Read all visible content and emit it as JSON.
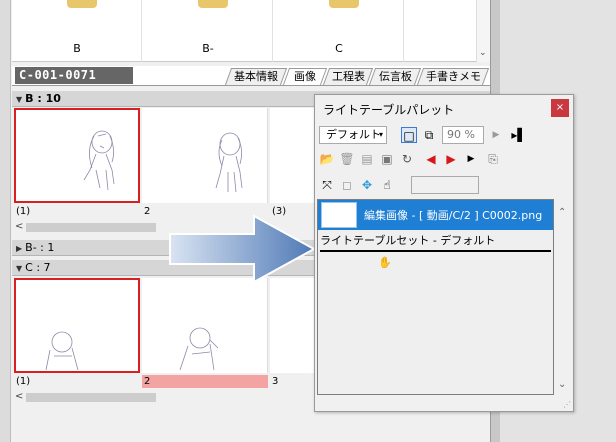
{
  "folders": [
    {
      "label": "B"
    },
    {
      "label": "B-"
    },
    {
      "label": "C"
    }
  ],
  "header": {
    "cut_title": "C-001-0071",
    "tabs": [
      "基本情報",
      "画像",
      "工程表",
      "伝言板",
      "手書きメモ"
    ]
  },
  "groups": [
    {
      "name": "B",
      "count": "10",
      "expanded": true,
      "thumbs": [
        {
          "label": "(1)",
          "selected": true
        },
        {
          "label": "2"
        },
        {
          "label": "(3)"
        }
      ]
    },
    {
      "name": "B-",
      "count": "1",
      "expanded": false
    },
    {
      "name": "C",
      "count": "7",
      "expanded": true,
      "thumbs": [
        {
          "label": "(1)",
          "selected": true
        },
        {
          "label": "2",
          "highlight": true
        },
        {
          "label": "3"
        }
      ]
    }
  ],
  "palette": {
    "title": "ライトテーブルパレット",
    "close": "×",
    "preset": "デフォルト",
    "opacity": "90 %",
    "list_item": "編集画像 - [ 動画/C/2 ] C0002.png",
    "set_label": "ライトテーブルセット - デフォルト"
  },
  "colors": {
    "selection_blue": "#1e7fd4",
    "selected_thumb_border": "#d92020",
    "current_frame_pink": "#f4a3a3",
    "close_red": "#c8383e",
    "cut_title_bg": "#666666"
  }
}
